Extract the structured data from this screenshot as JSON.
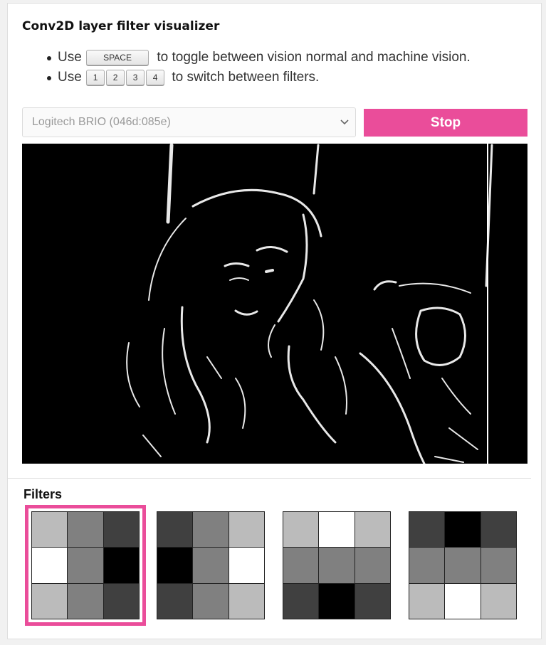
{
  "title": "Conv2D layer filter visualizer",
  "instructions": {
    "line1": {
      "prefix": "Use",
      "key": "SPACE",
      "suffix": "to toggle between vision normal and machine vision."
    },
    "line2": {
      "prefix": "Use",
      "keys": [
        "1",
        "2",
        "3",
        "4"
      ],
      "suffix": "to switch between filters."
    }
  },
  "camera_select": {
    "selected": "Logitech BRIO (046d:085e)"
  },
  "stop_button": {
    "label": "Stop",
    "color": "#ea4d9a"
  },
  "filters": {
    "title": "Filters",
    "selected_index": 0,
    "kernels": [
      [
        "#bbbbbb",
        "#808080",
        "#404040",
        "#ffffff",
        "#808080",
        "#000000",
        "#bbbbbb",
        "#808080",
        "#404040"
      ],
      [
        "#404040",
        "#808080",
        "#bbbbbb",
        "#000000",
        "#808080",
        "#ffffff",
        "#404040",
        "#808080",
        "#bbbbbb"
      ],
      [
        "#bbbbbb",
        "#ffffff",
        "#bbbbbb",
        "#808080",
        "#808080",
        "#808080",
        "#404040",
        "#000000",
        "#404040"
      ],
      [
        "#404040",
        "#000000",
        "#404040",
        "#808080",
        "#808080",
        "#808080",
        "#bbbbbb",
        "#ffffff",
        "#bbbbbb"
      ]
    ]
  }
}
